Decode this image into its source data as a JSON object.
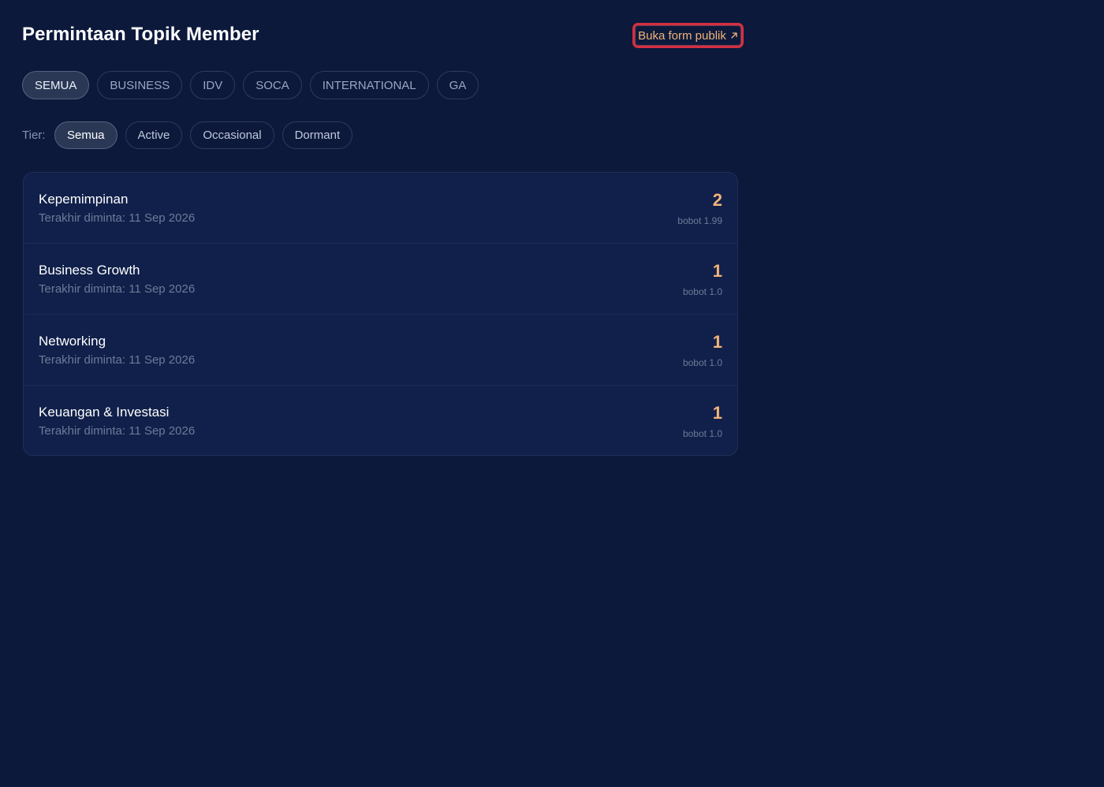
{
  "header": {
    "title": "Permintaan Topik Member",
    "open_form_label": "Buka form publik",
    "open_form_icon": "external-arrow-icon"
  },
  "group_filters": [
    {
      "label": "SEMUA",
      "active": true
    },
    {
      "label": "BUSINESS",
      "active": false
    },
    {
      "label": "IDV",
      "active": false
    },
    {
      "label": "SOCA",
      "active": false
    },
    {
      "label": "INTERNATIONAL",
      "active": false
    },
    {
      "label": "GA",
      "active": false
    }
  ],
  "tier_filter": {
    "label": "Tier:",
    "options": [
      {
        "label": "Semua",
        "active": true
      },
      {
        "label": "Active",
        "active": false
      },
      {
        "label": "Occasional",
        "active": false
      },
      {
        "label": "Dormant",
        "active": false
      }
    ]
  },
  "topics": [
    {
      "name": "Kepemimpinan",
      "last_requested": "Terakhir diminta: 11 Sep 2026",
      "count": "2",
      "weight": "bobot 1.99"
    },
    {
      "name": "Business Growth",
      "last_requested": "Terakhir diminta: 11 Sep 2026",
      "count": "1",
      "weight": "bobot 1.0"
    },
    {
      "name": "Networking",
      "last_requested": "Terakhir diminta: 11 Sep 2026",
      "count": "1",
      "weight": "bobot 1.0"
    },
    {
      "name": "Keuangan & Investasi",
      "last_requested": "Terakhir diminta: 11 Sep 2026",
      "count": "1",
      "weight": "bobot 1.0"
    }
  ],
  "colors": {
    "background": "#0c193b",
    "card": "#10204a",
    "accent_count": "#f2b27a",
    "button_border": "#d43040"
  }
}
